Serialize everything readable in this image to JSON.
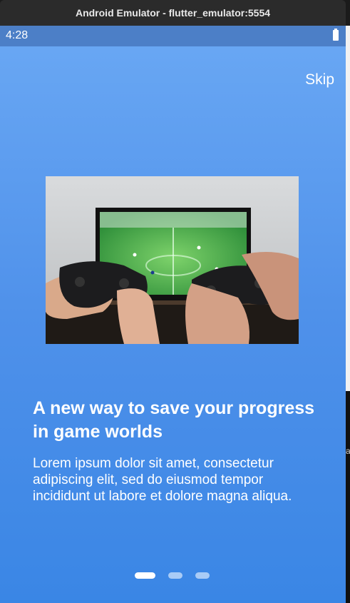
{
  "window": {
    "title": "Android Emulator - flutter_emulator:5554"
  },
  "statusbar": {
    "time": "4:28",
    "battery_icon": "battery-icon"
  },
  "onboarding": {
    "skip_label": "Skip",
    "title": "A new way to save your progress in game worlds",
    "body": "Lorem ipsum dolor sit amet, consectetur adipiscing elit, sed do eiusmod tempor incididunt ut labore et dolore magna aliqua.",
    "image_subject": "hands holding game controllers in front of a TV showing a soccer game",
    "page_indicator": {
      "pages": 3,
      "active_index": 0
    }
  },
  "edge": {
    "fragment": "a"
  },
  "colors": {
    "gradient_top": "#6aa8f4",
    "gradient_bottom": "#3a86e5",
    "statusbar": "#4c7fc7",
    "indicator_active": "#ffffff",
    "indicator_inactive": "#a9cbf6"
  }
}
